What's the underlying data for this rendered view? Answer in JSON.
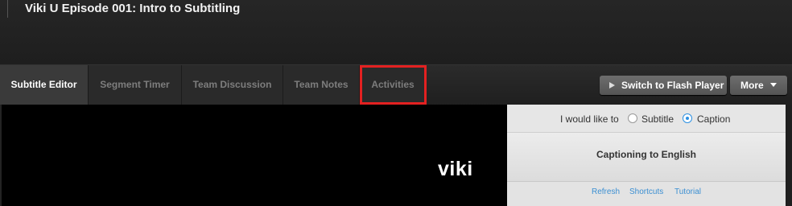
{
  "page": {
    "title": "Viki U Episode 001: Intro to Subtitling"
  },
  "tabs": [
    {
      "label": "Subtitle Editor"
    },
    {
      "label": "Segment Timer"
    },
    {
      "label": "Team Discussion"
    },
    {
      "label": "Team Notes"
    },
    {
      "label": "Activities"
    }
  ],
  "toolbar": {
    "flash_label": "Switch to Flash Player",
    "more_label": "More"
  },
  "video": {
    "logo_text": "viki"
  },
  "panel": {
    "mode_prompt": "I would like to",
    "options": [
      {
        "label": "Subtitle",
        "selected": false
      },
      {
        "label": "Caption",
        "selected": true
      }
    ],
    "heading": "Captioning to English",
    "links": [
      "Refresh",
      "Shortcuts",
      "Tutorial"
    ]
  },
  "colors": {
    "highlight": "#e32121",
    "accent": "#2c90e2",
    "link": "#3b8fd2"
  }
}
